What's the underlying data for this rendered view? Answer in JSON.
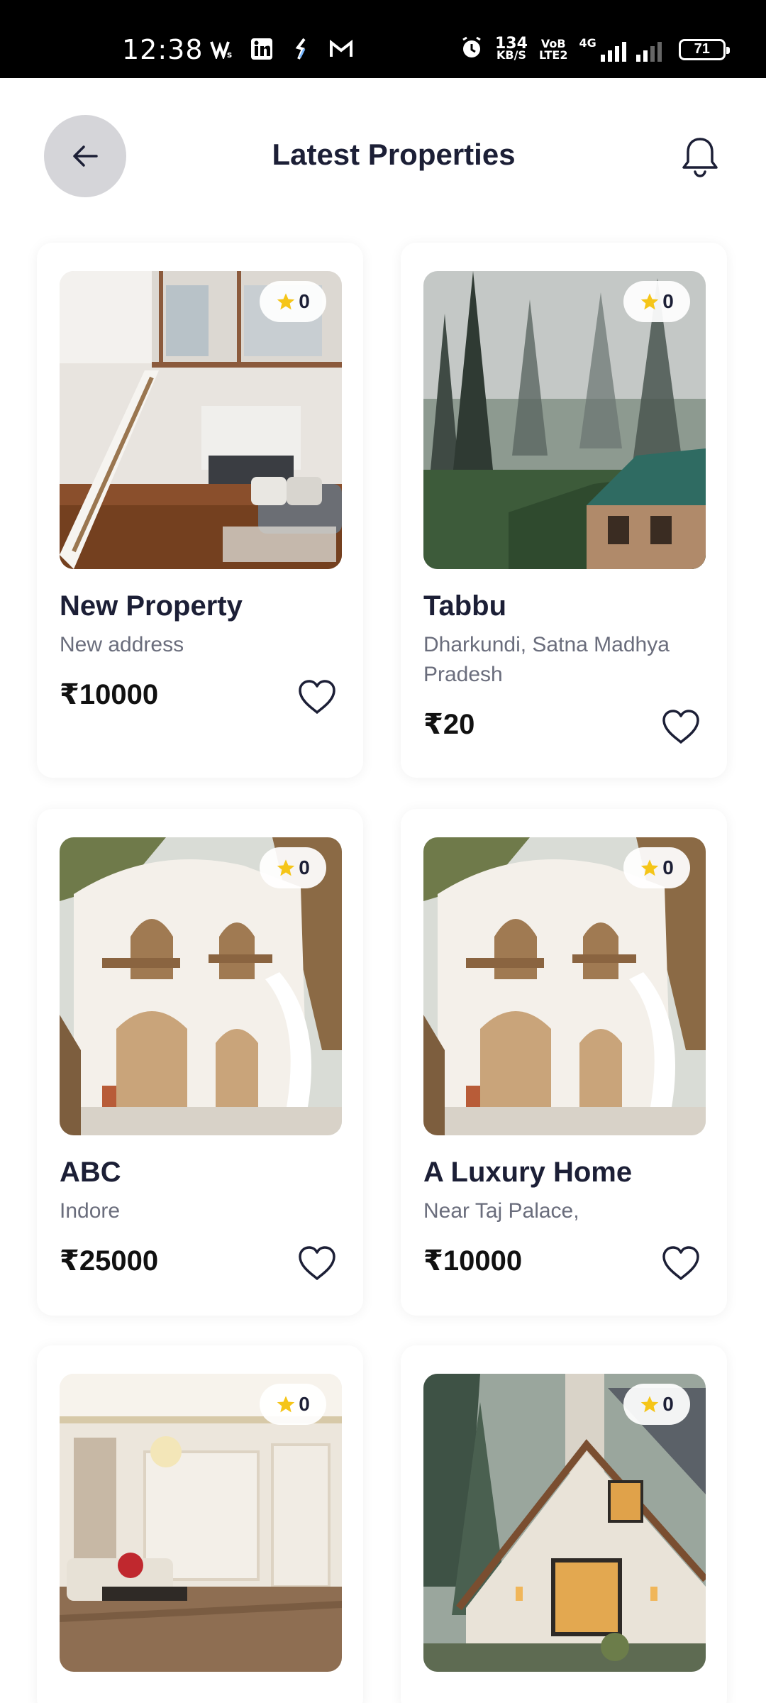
{
  "status_bar": {
    "time": "12:38",
    "speed_value": "134",
    "speed_unit": "KB/S",
    "volte_top": "VoB",
    "volte_bottom": "LTE2",
    "network": "4G",
    "battery": "71",
    "icons": [
      "wps-icon",
      "linkedin-icon",
      "app-icon",
      "gmail-icon",
      "alarm-icon",
      "signal-icon"
    ]
  },
  "header": {
    "title": "Latest Properties",
    "back_icon": "arrow-left-icon",
    "bell_icon": "bell-icon"
  },
  "properties": [
    {
      "title": "New Property",
      "address": "New address",
      "price": "₹10000",
      "rating": "0",
      "image": "interior-staircase"
    },
    {
      "title": "Tabbu",
      "address": "Dharkundi, Satna Madhya Pradesh",
      "price": "₹20",
      "rating": "0",
      "image": "misty-forest-house"
    },
    {
      "title": "ABC",
      "address": "Indore",
      "price": "₹25000",
      "rating": "0",
      "image": "white-villa"
    },
    {
      "title": "A Luxury Home",
      "address": "Near Taj Palace,",
      "price": "₹10000",
      "rating": "0",
      "image": "white-villa"
    },
    {
      "title": "",
      "address": "",
      "price": "",
      "rating": "0",
      "image": "luxury-living-room"
    },
    {
      "title": "",
      "address": "",
      "price": "",
      "rating": "0",
      "image": "cottage-in-woods"
    }
  ],
  "colors": {
    "accent_star": "#f5c518",
    "text_dark": "#1c1f36",
    "text_muted": "#6a6d7c",
    "back_button_bg": "#d5d5d9"
  }
}
